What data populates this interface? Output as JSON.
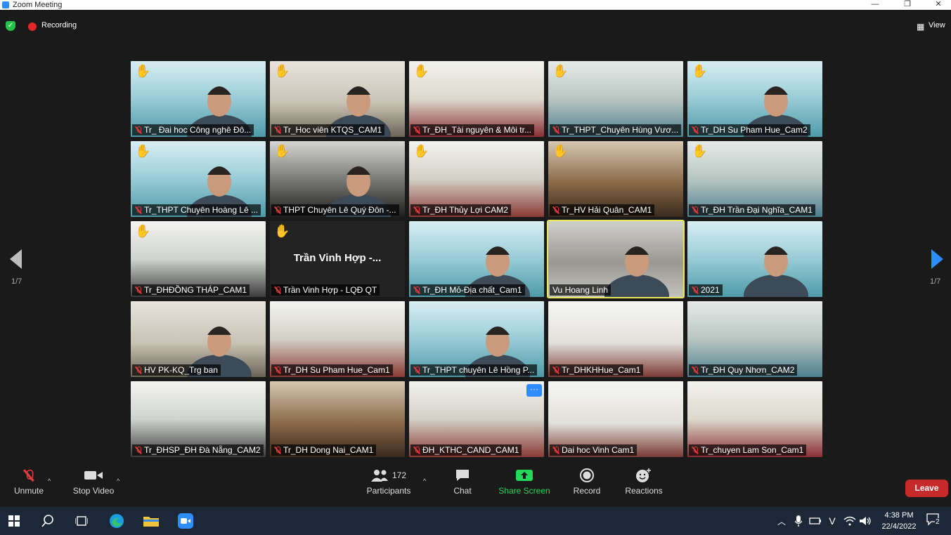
{
  "window": {
    "title": "Zoom Meeting",
    "minimize": "—",
    "maximize": "❐",
    "close": "✕"
  },
  "topbar": {
    "recording_label": "Recording",
    "view_label": "View"
  },
  "pagination": {
    "left": "1/7",
    "right": "1/7"
  },
  "tiles": [
    {
      "name": "Tr_ Đai hoc Công nghê Đô...",
      "muted": true,
      "hand": true,
      "scene": "banner",
      "person": true
    },
    {
      "name": "Tr_Hoc viên KTQS_CAM1",
      "muted": true,
      "hand": true,
      "scene": "office",
      "person": true
    },
    {
      "name": "Tr_ĐH_Tài nguyên & Môi tr...",
      "muted": true,
      "hand": true,
      "scene": "hall",
      "person": false
    },
    {
      "name": "Tr_THPT_Chuyên Hùng Vươ...",
      "muted": true,
      "hand": true,
      "scene": "lab",
      "person": false
    },
    {
      "name": "Tr_DH Su Pham Hue_Cam2",
      "muted": true,
      "hand": true,
      "scene": "banner",
      "person": true
    },
    {
      "name": "Tr_THPT Chuyên Hoàng Lê ...",
      "muted": true,
      "hand": true,
      "scene": "banner",
      "person": true
    },
    {
      "name": "THPT Chuyên Lê Quý Đôn -...",
      "muted": true,
      "hand": true,
      "scene": "dark",
      "person": true
    },
    {
      "name": "Tr_ĐH Thủy Lợi CAM2",
      "muted": true,
      "hand": true,
      "scene": "classroom",
      "person": false
    },
    {
      "name": "Tr_HV Hải Quân_CAM1",
      "muted": true,
      "hand": true,
      "scene": "wood",
      "person": false
    },
    {
      "name": "Tr_ĐH Trần Đại Nghĩa_CAM1",
      "muted": true,
      "hand": true,
      "scene": "lab",
      "person": false
    },
    {
      "name": "Tr_ĐHĐỒNG THÁP_CAM1",
      "muted": true,
      "hand": true,
      "scene": "meeting",
      "person": false
    },
    {
      "name": "Trần Vinh Hợp - LQĐ QT",
      "muted": true,
      "hand": true,
      "scene": "nameonly",
      "center": "Trần Vinh Hợp -...",
      "person": false
    },
    {
      "name": "Tr_ĐH Mỏ-Địa chất_Cam1",
      "muted": true,
      "hand": false,
      "scene": "banner",
      "person": true
    },
    {
      "name": "Vu Hoang Linh",
      "muted": false,
      "hand": false,
      "scene": "blur",
      "person": true,
      "active": true
    },
    {
      "name": "2021",
      "muted": true,
      "hand": false,
      "scene": "banner",
      "person": true
    },
    {
      "name": "HV PK-KQ_Trg ban",
      "muted": true,
      "hand": false,
      "scene": "office",
      "person": true
    },
    {
      "name": "Tr_DH Su Pham Hue_Cam1",
      "muted": true,
      "hand": false,
      "scene": "classroom",
      "person": false
    },
    {
      "name": "Tr_THPT chuyên Lê Hồng P...",
      "muted": true,
      "hand": false,
      "scene": "banner",
      "person": true
    },
    {
      "name": "Tr_DHKHHue_Cam1",
      "muted": true,
      "hand": false,
      "scene": "white",
      "person": false
    },
    {
      "name": "Tr_ĐH Quy Nhơn_CAM2",
      "muted": true,
      "hand": false,
      "scene": "lab",
      "person": false
    },
    {
      "name": "Tr_ĐHSP_ĐH Đà Nẵng_CAM2",
      "muted": true,
      "hand": false,
      "scene": "meeting",
      "person": false
    },
    {
      "name": "Tr_DH Dong Nai_CAM1",
      "muted": true,
      "hand": false,
      "scene": "wood",
      "person": false
    },
    {
      "name": "ĐH_KTHC_CAND_CAM1",
      "muted": true,
      "hand": false,
      "scene": "classroom",
      "person": false,
      "more": "···"
    },
    {
      "name": "Dai hoc Vinh Cam1",
      "muted": true,
      "hand": false,
      "scene": "white",
      "person": false
    },
    {
      "name": "Tr_chuyen Lam Son_Cam1",
      "muted": true,
      "hand": false,
      "scene": "hall",
      "person": false
    }
  ],
  "toolbar": {
    "unmute": "Unmute",
    "stop_video": "Stop Video",
    "participants": "Participants",
    "participants_count": "172",
    "chat": "Chat",
    "share_screen": "Share Screen",
    "record": "Record",
    "reactions": "Reactions",
    "leave": "Leave"
  },
  "taskbar": {
    "time": "4:38 PM",
    "date": "22/4/2022",
    "notifications": "2"
  },
  "colors": {
    "accent": "#2d8cff",
    "share": "#23d959",
    "leave": "#c72a2a",
    "active_border": "#e8e85a"
  }
}
